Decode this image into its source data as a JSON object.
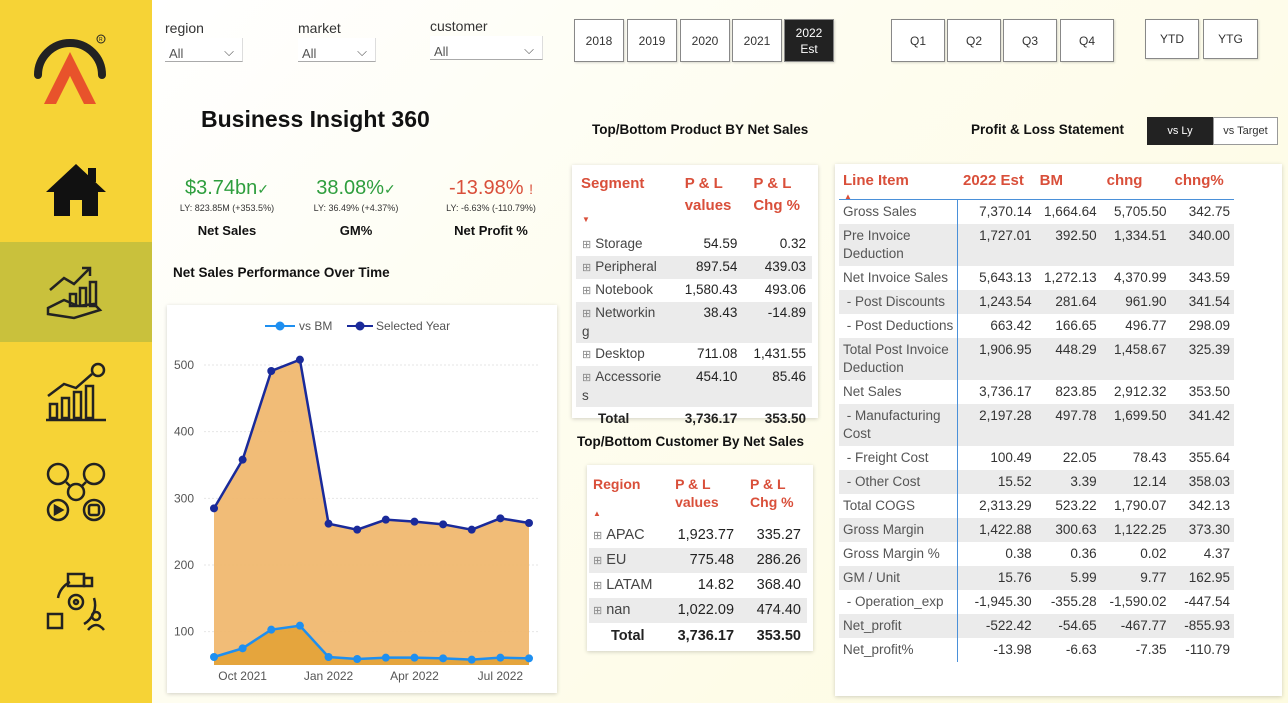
{
  "sidebar": {
    "items": [
      {
        "icon": "home-icon"
      },
      {
        "icon": "growth-chart-hand-icon"
      },
      {
        "icon": "finance-bar-chart-icon"
      },
      {
        "icon": "social-media-icon"
      },
      {
        "icon": "supply-chain-icon"
      }
    ]
  },
  "filters": {
    "region": {
      "label": "region",
      "value": "All"
    },
    "market": {
      "label": "market",
      "value": "All"
    },
    "customer": {
      "label": "customer",
      "value": "All"
    }
  },
  "years": [
    "2018",
    "2019",
    "2020",
    "2021",
    "2022\nEst"
  ],
  "quarters": [
    "Q1",
    "Q2",
    "Q3",
    "Q4"
  ],
  "periods": [
    "YTD",
    "YTG"
  ],
  "header": {
    "title": "Business Insight 360"
  },
  "kpis": [
    {
      "value": "$3.74bn",
      "mark": "✓",
      "ly": "LY: 823.85M (+353.5%)",
      "name": "Net Sales",
      "color": "#2e9e3e"
    },
    {
      "value": "38.08%",
      "mark": "✓",
      "ly": "LY: 36.49% (+4.37%)",
      "name": "GM%",
      "color": "#2e9e3e"
    },
    {
      "value": "-13.98%",
      "mark": "!",
      "ly": "LY: -6.63% (-110.79%)",
      "name": "Net Profit %",
      "color": "#d94f3a"
    }
  ],
  "chart_data": {
    "type": "area",
    "title": "Net Sales Performance Over Time",
    "legend": [
      "vs BM",
      "Selected Year"
    ],
    "colors": {
      "vs BM": "#1e8ff0",
      "Selected Year": "#1a2a9a",
      "fill": "#f0b870"
    },
    "x_tick_labels": [
      "Oct 2021",
      "Jan 2022",
      "Apr 2022",
      "Jul 2022"
    ],
    "y_ticks": [
      100,
      200,
      300,
      400,
      500
    ],
    "ylim": [
      50,
      530
    ],
    "points": 12,
    "series": [
      {
        "name": "Selected Year",
        "values": [
          285,
          358,
          491,
          508,
          262,
          253,
          268,
          265,
          261,
          253,
          270,
          263
        ]
      },
      {
        "name": "vs BM",
        "values": [
          62,
          75,
          103,
          109,
          62,
          59,
          61,
          61,
          60,
          58,
          61,
          60
        ]
      }
    ]
  },
  "product_table": {
    "title": "Top/Bottom Product BY Net Sales",
    "headers": [
      "Segment",
      "P & L\nvalues",
      "P & L\nChg %"
    ],
    "rows": [
      [
        "Storage",
        "54.59",
        "0.32"
      ],
      [
        "Peripheral",
        "897.54",
        "439.03"
      ],
      [
        "Notebook",
        "1,580.43",
        "493.06"
      ],
      [
        "Networkin\ng",
        "38.43",
        "-14.89"
      ],
      [
        "Desktop",
        "711.08",
        "1,431.55"
      ],
      [
        "Accessorie\ns",
        "454.10",
        "85.46"
      ]
    ],
    "total": [
      "Total",
      "3,736.17",
      "353.50"
    ]
  },
  "customer_table": {
    "title": "Top/Bottom Customer By Net Sales",
    "headers": [
      "Region",
      "P & L\nvalues",
      "P & L\nChg %"
    ],
    "rows": [
      [
        "APAC",
        "1,923.77",
        "335.27"
      ],
      [
        "EU",
        "775.48",
        "286.26"
      ],
      [
        "LATAM",
        "14.82",
        "368.40"
      ],
      [
        "nan",
        "1,022.09",
        "474.40"
      ]
    ],
    "total": [
      "Total",
      "3,736.17",
      "353.50"
    ]
  },
  "pl": {
    "title": "Profit & Loss Statement",
    "toggle": [
      "vs Ly",
      "vs Target"
    ],
    "headers": [
      "Line Item",
      "2022 Est",
      "BM",
      "chng",
      "chng%"
    ],
    "rows": [
      [
        "Gross Sales",
        "7,370.14",
        "1,664.64",
        "5,705.50",
        "342.75"
      ],
      [
        "Pre Invoice\nDeduction",
        "1,727.01",
        "392.50",
        "1,334.51",
        "340.00"
      ],
      [
        "Net Invoice Sales",
        "5,643.13",
        "1,272.13",
        "4,370.99",
        "343.59"
      ],
      [
        " - Post Discounts",
        "1,243.54",
        "281.64",
        "961.90",
        "341.54"
      ],
      [
        " - Post Deductions",
        "663.42",
        "166.65",
        "496.77",
        "298.09"
      ],
      [
        "Total Post Invoice\nDeduction",
        "1,906.95",
        "448.29",
        "1,458.67",
        "325.39"
      ],
      [
        "Net Sales",
        "3,736.17",
        "823.85",
        "2,912.32",
        "353.50"
      ],
      [
        " - Manufacturing\nCost",
        "2,197.28",
        "497.78",
        "1,699.50",
        "341.42"
      ],
      [
        " - Freight Cost",
        "100.49",
        "22.05",
        "78.43",
        "355.64"
      ],
      [
        " - Other Cost",
        "15.52",
        "3.39",
        "12.14",
        "358.03"
      ],
      [
        "Total COGS",
        "2,313.29",
        "523.22",
        "1,790.07",
        "342.13"
      ],
      [
        "Gross Margin",
        "1,422.88",
        "300.63",
        "1,122.25",
        "373.30"
      ],
      [
        "Gross Margin %",
        "0.38",
        "0.36",
        "0.02",
        "4.37"
      ],
      [
        "GM / Unit",
        "15.76",
        "5.99",
        "9.77",
        "162.95"
      ],
      [
        " - Operation_exp",
        "-1,945.30",
        "-355.28",
        "-1,590.02",
        "-447.54"
      ],
      [
        "Net_profit",
        "-522.42",
        "-54.65",
        "-467.77",
        "-855.93"
      ],
      [
        "Net_profit%",
        "-13.98",
        "-6.63",
        "-7.35",
        "-110.79"
      ]
    ]
  }
}
